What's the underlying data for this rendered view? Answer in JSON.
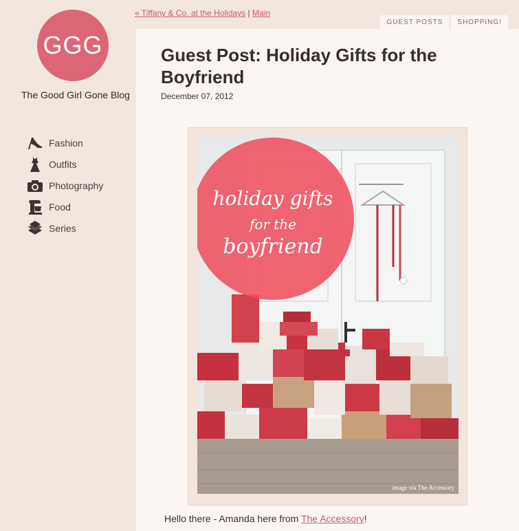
{
  "sidebar": {
    "logo_text": "GGG",
    "blog_name": "The Good Girl Gone Blog",
    "nav": [
      {
        "label": "Fashion",
        "icon": "high-heel-icon"
      },
      {
        "label": "Outfits",
        "icon": "dress-icon"
      },
      {
        "label": "Photography",
        "icon": "camera-icon"
      },
      {
        "label": "Food",
        "icon": "stand-mixer-icon"
      },
      {
        "label": "Series",
        "icon": "books-icon"
      }
    ]
  },
  "toplinks": {
    "prev": "« Tiffany & Co. at the Holidays",
    "separator": "|",
    "main": "Main"
  },
  "tabs": [
    "GUEST POSTS",
    "SHOPPING!"
  ],
  "post": {
    "title": "Guest Post: Holiday Gifts for the Boyfriend",
    "date": "December 07, 2012",
    "image": {
      "line1": "holiday gifts",
      "line2": "for the",
      "line3": "boyfriend",
      "credit": "image via The Accessory"
    },
    "intro_prefix": "Hello there - Amanda here from ",
    "intro_link": "The Accessory",
    "intro_suffix": "!"
  },
  "colors": {
    "accent": "#dd6676",
    "background": "#f3e6df",
    "panel": "#fbf6f3",
    "link": "#c45c6e"
  }
}
